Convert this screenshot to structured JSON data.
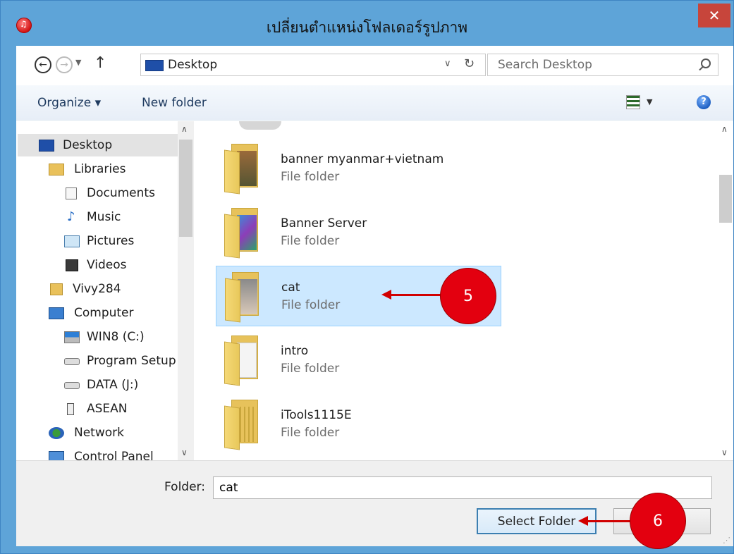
{
  "window": {
    "title": "เปลี่ยนตำแหน่งโฟลเดอร์รูปภาพ",
    "close_glyph": "✕"
  },
  "address": {
    "location": "Desktop",
    "search_placeholder": "Search Desktop"
  },
  "toolbar": {
    "organize": "Organize ▾",
    "new_folder": "New folder"
  },
  "nav": [
    {
      "label": "Desktop",
      "icon": "desktop-icon",
      "selected": true
    },
    {
      "label": "Libraries",
      "icon": "libraries-icon"
    },
    {
      "label": "Documents",
      "icon": "document-icon"
    },
    {
      "label": "Music",
      "icon": "music-icon"
    },
    {
      "label": "Pictures",
      "icon": "pictures-icon"
    },
    {
      "label": "Videos",
      "icon": "videos-icon"
    },
    {
      "label": "Vivy284",
      "icon": "user-icon"
    },
    {
      "label": "Computer",
      "icon": "computer-icon"
    },
    {
      "label": "WIN8 (C:)",
      "icon": "drive-c-icon"
    },
    {
      "label": "Program Setup",
      "icon": "drive-icon"
    },
    {
      "label": "DATA (J:)",
      "icon": "drive-icon"
    },
    {
      "label": "ASEAN",
      "icon": "usb-drive-icon"
    },
    {
      "label": "Network",
      "icon": "network-icon"
    },
    {
      "label": "Control Panel",
      "icon": "control-panel-icon"
    }
  ],
  "files": [
    {
      "name": "banner myanmar+vietnam",
      "type": "File folder"
    },
    {
      "name": "Banner Server",
      "type": "File folder"
    },
    {
      "name": "cat",
      "type": "File folder",
      "selected": true
    },
    {
      "name": "intro",
      "type": "File folder"
    },
    {
      "name": "iTools1115E",
      "type": "File folder"
    }
  ],
  "bottom": {
    "folder_label": "Folder:",
    "folder_value": "cat",
    "select_button": "Select Folder"
  },
  "callouts": {
    "step5": "5",
    "step6": "6"
  },
  "colors": {
    "titlebar": "#5ea4d8",
    "selection": "#cce8ff",
    "callout": "#e3000f"
  }
}
